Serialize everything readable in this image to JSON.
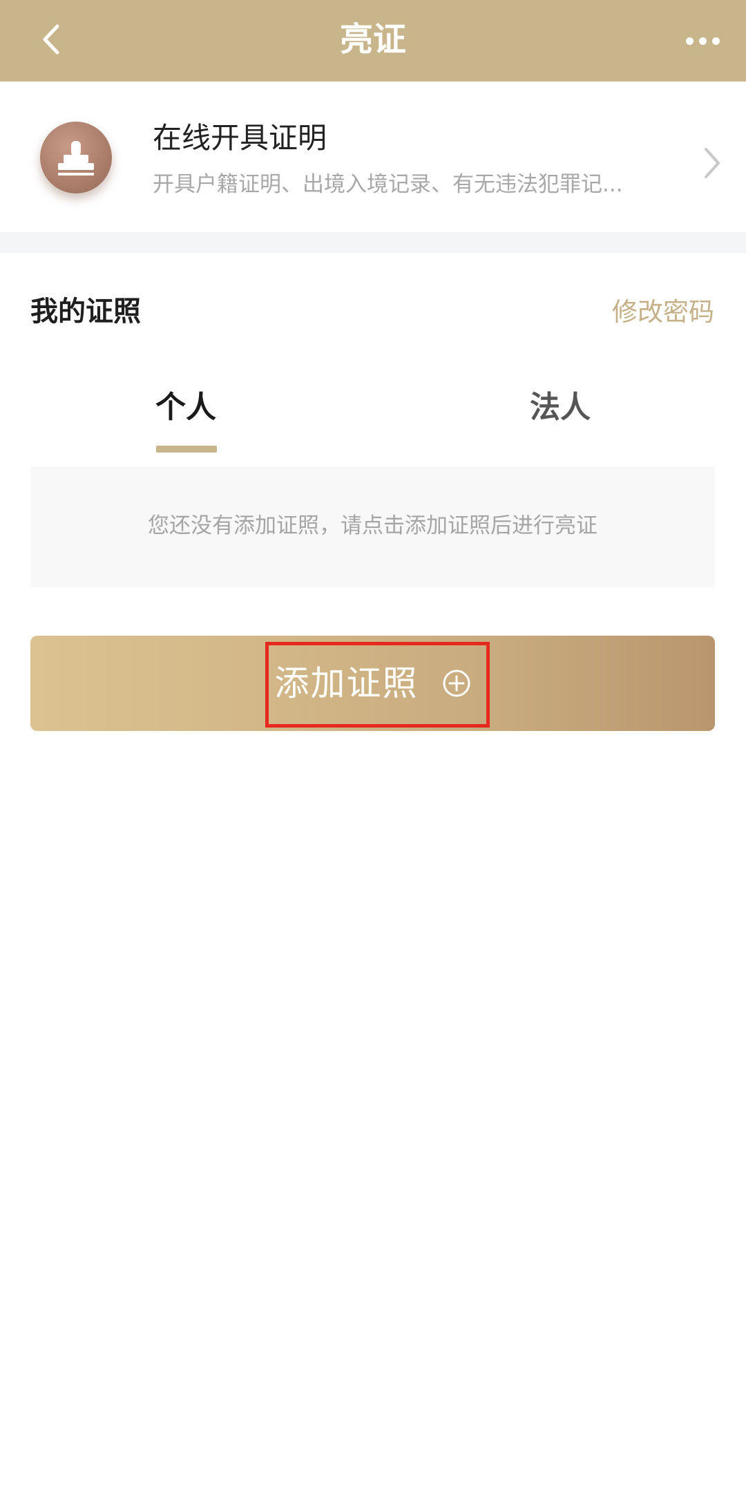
{
  "header": {
    "title": "亮证"
  },
  "cert_card": {
    "title": "在线开具证明",
    "description": "开具户籍证明、出境入境记录、有无违法犯罪记..."
  },
  "licenses": {
    "section_title": "我的证照",
    "change_password": "修改密码",
    "tabs": [
      {
        "label": "个人",
        "selected": true
      },
      {
        "label": "法人",
        "selected": false
      }
    ],
    "empty_message": "您还没有添加证照，请点击添加证照后进行亮证",
    "add_button_label": "添加证照"
  },
  "colors": {
    "header_bg": "#c9b58b",
    "accent_gold": "#c5b088",
    "highlight_red": "#e5291f"
  },
  "icons": {
    "back": "chevron-left-icon",
    "more": "more-dots-icon",
    "cert": "stamp-icon",
    "chevron": "chevron-right-icon",
    "add": "plus-circle-icon"
  }
}
